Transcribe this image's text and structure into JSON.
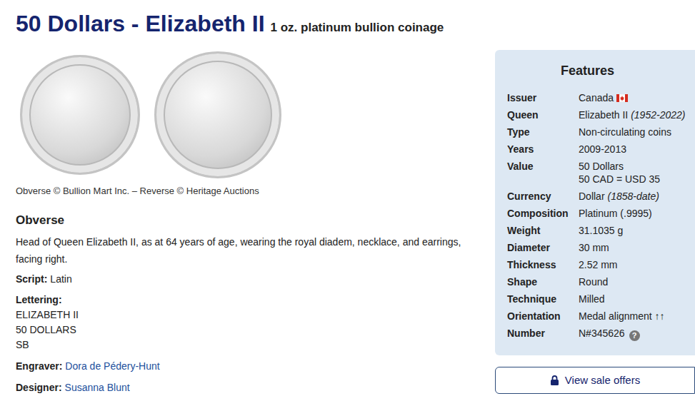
{
  "title": "50 Dollars - Elizabeth II",
  "subtitle": "1 oz. platinum bullion coinage",
  "images": {
    "caption": "Obverse © Bullion Mart Inc. – Reverse © Heritage Auctions"
  },
  "obverse": {
    "heading": "Obverse",
    "description": "Head of Queen Elizabeth II, as at 64 years of age, wearing the royal diadem, necklace, and earrings, facing right.",
    "script": {
      "label": "Script:",
      "value": "Latin"
    },
    "lettering": {
      "label": "Lettering:",
      "lines": [
        "ELIZABETH II",
        "50 DOLLARS",
        "SB"
      ]
    },
    "credits": [
      {
        "label": "Engraver:",
        "value": "Dora de Pédery-Hunt"
      },
      {
        "label": "Designer:",
        "value": "Susanna Blunt"
      }
    ]
  },
  "features": {
    "title": "Features",
    "rows": [
      {
        "label": "Issuer",
        "kind": "flag",
        "lines": [
          [
            {
              "text": "Canada",
              "italic": false
            }
          ]
        ]
      },
      {
        "label": "Queen",
        "kind": "text",
        "lines": [
          [
            {
              "text": "Elizabeth II",
              "italic": false
            },
            {
              "text": "(1952-2022)",
              "italic": true
            }
          ]
        ]
      },
      {
        "label": "Type",
        "kind": "text",
        "lines": [
          [
            {
              "text": "Non-circulating coins",
              "italic": false
            }
          ]
        ]
      },
      {
        "label": "Years",
        "kind": "text",
        "lines": [
          [
            {
              "text": "2009-2013",
              "italic": false
            }
          ]
        ]
      },
      {
        "label": "Value",
        "kind": "text",
        "lines": [
          [
            {
              "text": "50 Dollars",
              "italic": false
            }
          ],
          [
            {
              "text": "50 CAD = USD 35",
              "italic": false
            }
          ]
        ]
      },
      {
        "label": "Currency",
        "kind": "text",
        "lines": [
          [
            {
              "text": "Dollar",
              "italic": false
            },
            {
              "text": "(1858-date)",
              "italic": true
            }
          ]
        ]
      },
      {
        "label": "Composition",
        "kind": "text",
        "lines": [
          [
            {
              "text": "Platinum (.9995)",
              "italic": false
            }
          ]
        ]
      },
      {
        "label": "Weight",
        "kind": "text",
        "lines": [
          [
            {
              "text": "31.1035 g",
              "italic": false
            }
          ]
        ]
      },
      {
        "label": "Diameter",
        "kind": "text",
        "lines": [
          [
            {
              "text": "30 mm",
              "italic": false
            }
          ]
        ]
      },
      {
        "label": "Thickness",
        "kind": "text",
        "lines": [
          [
            {
              "text": "2.52 mm",
              "italic": false
            }
          ]
        ]
      },
      {
        "label": "Shape",
        "kind": "text",
        "lines": [
          [
            {
              "text": "Round",
              "italic": false
            }
          ]
        ]
      },
      {
        "label": "Technique",
        "kind": "text",
        "lines": [
          [
            {
              "text": "Milled",
              "italic": false
            }
          ]
        ]
      },
      {
        "label": "Orientation",
        "kind": "text",
        "lines": [
          [
            {
              "text": "Medal alignment ↑↑",
              "italic": false
            }
          ]
        ]
      },
      {
        "label": "Number",
        "kind": "help",
        "icon": "?",
        "lines": [
          [
            {
              "text": "N#345626",
              "italic": false
            }
          ]
        ]
      }
    ],
    "button": {
      "label": "View sale offers"
    }
  }
}
